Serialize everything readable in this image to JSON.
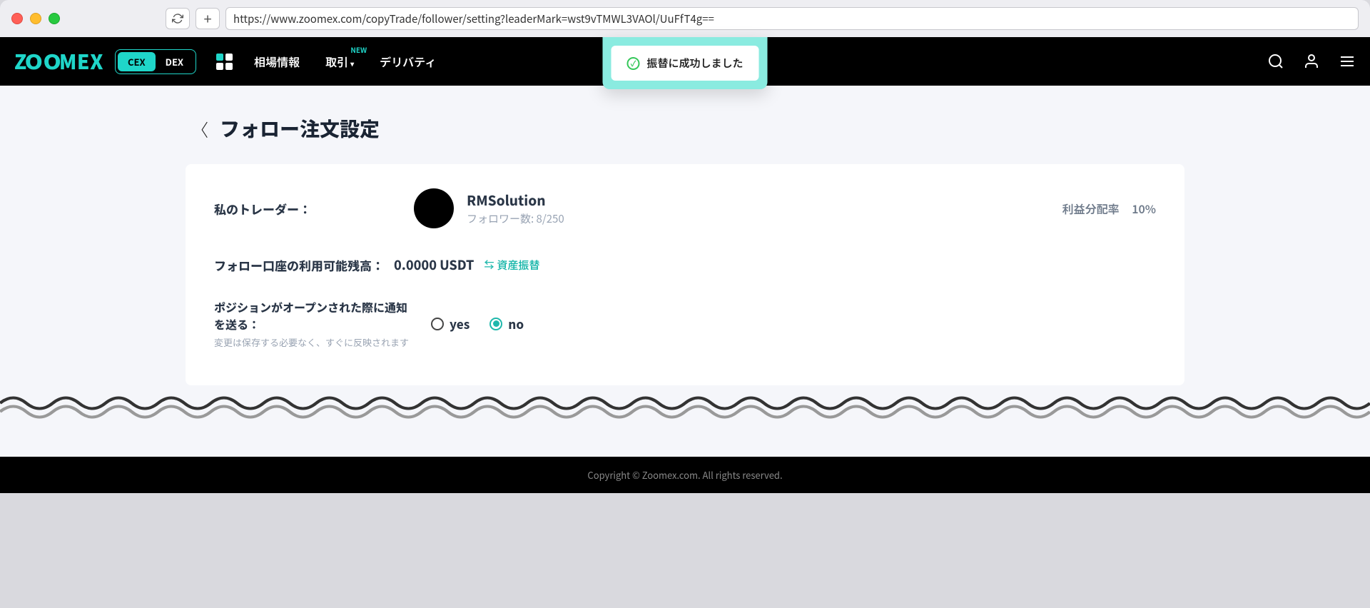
{
  "browser": {
    "url": "https://www.zoomex.com/copyTrade/follower/setting?leaderMark=wst9vTMWL3VAOl/UuFfT4g=="
  },
  "header": {
    "logo": "ZOOMEX",
    "cex": "CEX",
    "dex": "DEX",
    "nav_market": "相場情報",
    "nav_trade": "取引",
    "nav_trade_badge": "NEW",
    "nav_derivative": "デリバティ"
  },
  "toast": {
    "message": "振替に成功しました"
  },
  "page": {
    "title": "フォロー注文設定",
    "trader_label": "私のトレーダー：",
    "trader_name": "RMSolution",
    "follower_count": "フォロワー数: 8/250",
    "profit_share_label": "利益分配率",
    "profit_share_value": "10%",
    "balance_label": "フォロー口座の利用可能残高：",
    "balance_value": "0.0000 USDT",
    "transfer_link": "資産振替",
    "notify_title": "ポジションがオープンされた際に通知を送る：",
    "notify_sub": "変更は保存する必要なく、すぐに反映されます",
    "radio_yes": "yes",
    "radio_no": "no"
  },
  "footer": {
    "copyright": "Copyright © Zoomex.com. All rights reserved."
  }
}
